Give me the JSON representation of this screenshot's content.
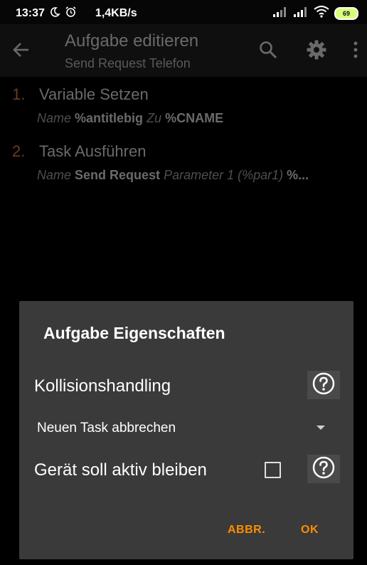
{
  "status_bar": {
    "time": "13:37",
    "speed": "1,4KB/s",
    "battery": "69"
  },
  "toolbar": {
    "title": "Aufgabe editieren",
    "subtitle": "Send Request Telefon"
  },
  "actions": [
    {
      "number": "1.",
      "title": "Variable Setzen",
      "params": [
        {
          "key": "Name",
          "value": "%antitlebig"
        },
        {
          "key": "Zu",
          "value": "%CNAME"
        }
      ]
    },
    {
      "number": "2.",
      "title": "Task Ausführen",
      "params": [
        {
          "key": "Name",
          "value": "Send Request"
        },
        {
          "key": "Parameter 1 (%par1)",
          "value": "%..."
        }
      ]
    }
  ],
  "dialog": {
    "title": "Aufgabe Eigenschaften",
    "collision_label": "Kollisionshandling",
    "collision_value": "Neuen Task abbrechen",
    "stay_awake_label": "Gerät soll aktiv bleiben",
    "stay_awake_checked": false,
    "cancel_label": "ABBR.",
    "ok_label": "OK"
  },
  "colors": {
    "accent": "#ff8c00",
    "dialog_bg": "#3a3a3a",
    "number": "#6f3a1a"
  }
}
